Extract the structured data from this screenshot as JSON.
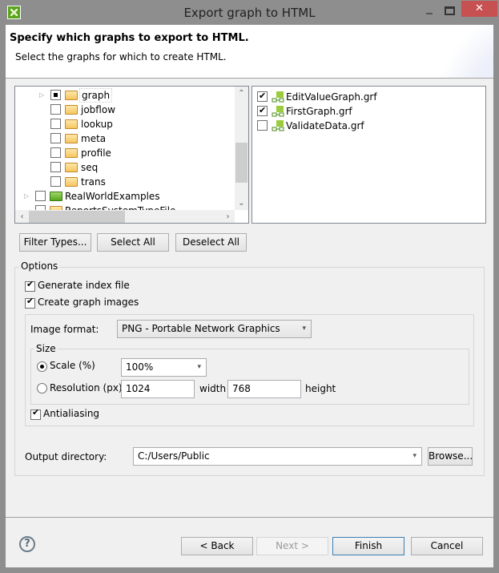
{
  "window": {
    "title": "Export graph to HTML",
    "minimize_icon": "minimize-icon",
    "maximize_icon": "maximize-icon",
    "close_icon": "close-icon",
    "close_glyph": "✕"
  },
  "header": {
    "title": "Specify which graphs to export to HTML.",
    "subtitle": "Select the graphs for which to create HTML."
  },
  "tree": {
    "items": [
      {
        "label": "graph",
        "state": "partial",
        "expandable": true,
        "icon": "folder-icon"
      },
      {
        "label": "jobflow",
        "state": "unchecked",
        "icon": "folder-icon"
      },
      {
        "label": "lookup",
        "state": "unchecked",
        "icon": "folder-icon"
      },
      {
        "label": "meta",
        "state": "unchecked",
        "icon": "folder-icon"
      },
      {
        "label": "profile",
        "state": "unchecked",
        "icon": "folder-icon"
      },
      {
        "label": "seq",
        "state": "unchecked",
        "icon": "folder-icon"
      },
      {
        "label": "trans",
        "state": "unchecked",
        "icon": "folder-icon"
      },
      {
        "label": "RealWorldExamples",
        "state": "unchecked",
        "expandable": true,
        "icon": "project-icon"
      },
      {
        "label": "ReportsSystemTypeFile",
        "state": "unchecked",
        "expandable": true,
        "icon": "folder-icon"
      }
    ]
  },
  "files": {
    "items": [
      {
        "label": "EditValueGraph.grf",
        "checked": true
      },
      {
        "label": "FirstGraph.grf",
        "checked": true
      },
      {
        "label": "ValidateData.grf",
        "checked": false
      }
    ]
  },
  "selection_buttons": {
    "filter_types": "Filter Types...",
    "select_all": "Select All",
    "deselect_all": "Deselect All"
  },
  "options": {
    "group_label": "Options",
    "generate_index": {
      "label": "Generate index file",
      "checked": true
    },
    "create_images": {
      "label": "Create graph images",
      "checked": true
    },
    "image_format_label": "Image format:",
    "image_format_value": "PNG - Portable Network Graphics",
    "size_group_label": "Size",
    "scale": {
      "label": "Scale (%)",
      "selected": true,
      "value": "100%"
    },
    "resolution": {
      "label": "Resolution (px)",
      "selected": false,
      "width": "1024",
      "width_label": "width",
      "height": "768",
      "height_label": "height"
    },
    "antialiasing": {
      "label": "Antialiasing",
      "checked": true
    },
    "output_dir_label": "Output directory:",
    "output_dir_value": "C:/Users/Public",
    "browse_label": "Browse..."
  },
  "footer": {
    "help_glyph": "?",
    "back": "< Back",
    "next": "Next >",
    "finish": "Finish",
    "cancel": "Cancel"
  }
}
